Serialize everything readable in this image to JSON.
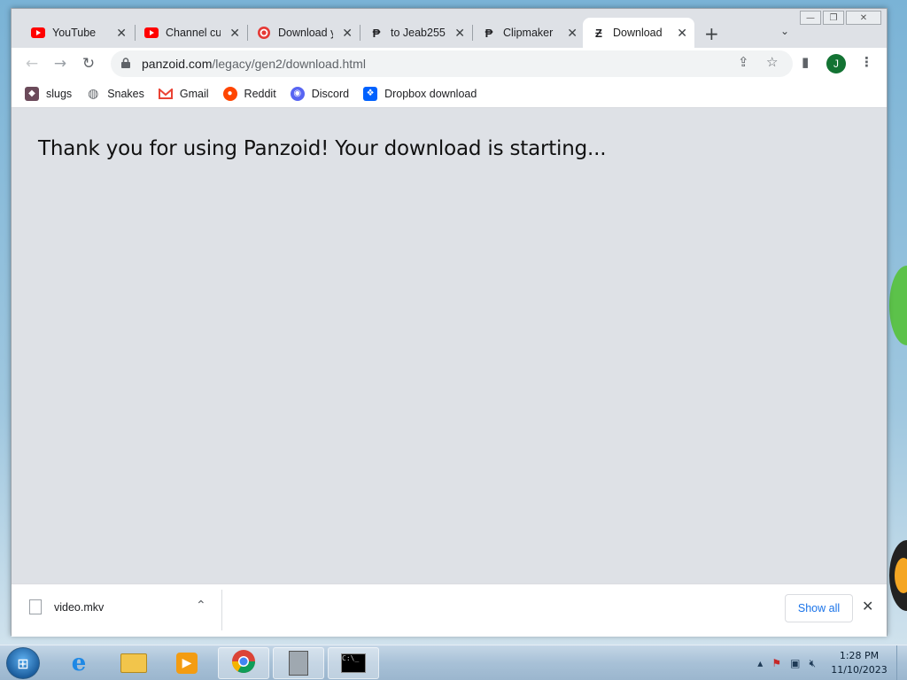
{
  "window_controls": {
    "minimize": "—",
    "restore": "❐",
    "close": "✕"
  },
  "tabs": [
    {
      "title": "YouTube",
      "icon": "youtube-icon",
      "active": false
    },
    {
      "title": "Channel cus",
      "icon": "youtube-icon",
      "active": false
    },
    {
      "title": "Download y",
      "icon": "download-site-icon",
      "active": false
    },
    {
      "title": "to Jeab255",
      "icon": "panzoid-icon",
      "active": false
    },
    {
      "title": "Clipmaker",
      "icon": "panzoid-icon",
      "active": false
    },
    {
      "title": "Download",
      "icon": "panzoid-icon",
      "active": true
    }
  ],
  "toolbar": {
    "url_host": "panzoid.com",
    "url_path": "/legacy/gen2/download.html",
    "profile_initial": "J"
  },
  "bookmarks": [
    {
      "label": "slugs",
      "icon": "slugs-icon",
      "color": "#6b4a5a"
    },
    {
      "label": "Snakes",
      "icon": "globe-icon",
      "color": "#5f6368"
    },
    {
      "label": "Gmail",
      "icon": "gmail-icon",
      "color": "#ea4335"
    },
    {
      "label": "Reddit",
      "icon": "reddit-icon",
      "color": "#ff4500"
    },
    {
      "label": "Discord",
      "icon": "discord-icon",
      "color": "#5865f2"
    },
    {
      "label": "Dropbox download",
      "icon": "dropbox-icon",
      "color": "#0061fe"
    }
  ],
  "page": {
    "headline": "Thank you for using Panzoid! Your download is starting..."
  },
  "download_bar": {
    "filename": "video.mkv",
    "show_all": "Show all"
  },
  "taskbar": {
    "time": "1:28 PM",
    "date": "11/10/2023"
  }
}
